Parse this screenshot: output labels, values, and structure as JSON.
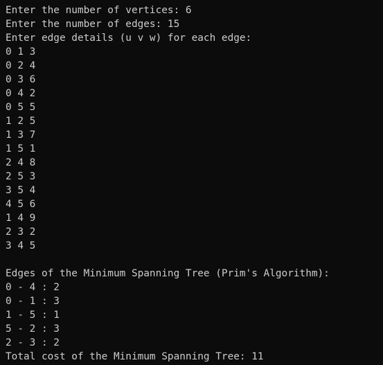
{
  "terminal": {
    "background": "#0c0c0c",
    "foreground": "#cccccc",
    "lines": [
      "Enter the number of vertices: 6",
      "Enter the number of edges: 15",
      "Enter edge details (u v w) for each edge:",
      "0 1 3",
      "0 2 4",
      "0 3 6",
      "0 4 2",
      "0 5 5",
      "1 2 5",
      "1 3 7",
      "1 5 1",
      "2 4 8",
      "2 5 3",
      "3 5 4",
      "4 5 6",
      "1 4 9",
      "2 3 2",
      "3 4 5",
      "",
      "Edges of the Minimum Spanning Tree (Prim's Algorithm):",
      "0 - 4 : 2",
      "0 - 1 : 3",
      "1 - 5 : 1",
      "5 - 2 : 3",
      "2 - 3 : 2",
      "Total cost of the Minimum Spanning Tree: 11"
    ]
  }
}
